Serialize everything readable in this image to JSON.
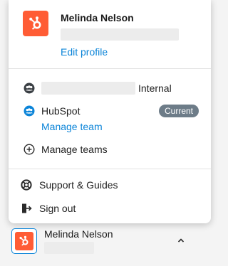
{
  "account": {
    "name": "Melinda Nelson",
    "edit_profile_label": "Edit profile"
  },
  "teams": {
    "internal_label": "Internal",
    "hubspot_label": "HubSpot",
    "current_badge": "Current",
    "manage_team_label": "Manage team",
    "manage_teams_label": "Manage teams"
  },
  "menu": {
    "support_label": "Support & Guides",
    "signout_label": "Sign out"
  },
  "footer": {
    "name": "Melinda Nelson"
  },
  "colors": {
    "brand": "#ff5c35",
    "link": "#0b84d8",
    "badge": "#6d7c88"
  },
  "icons": {
    "logo": "hubspot-sprocket-icon",
    "team": "team-people-icon",
    "add": "plus-circle-icon",
    "support": "lifebuoy-icon",
    "signout": "sign-out-icon",
    "expand": "chevron-up-icon"
  }
}
